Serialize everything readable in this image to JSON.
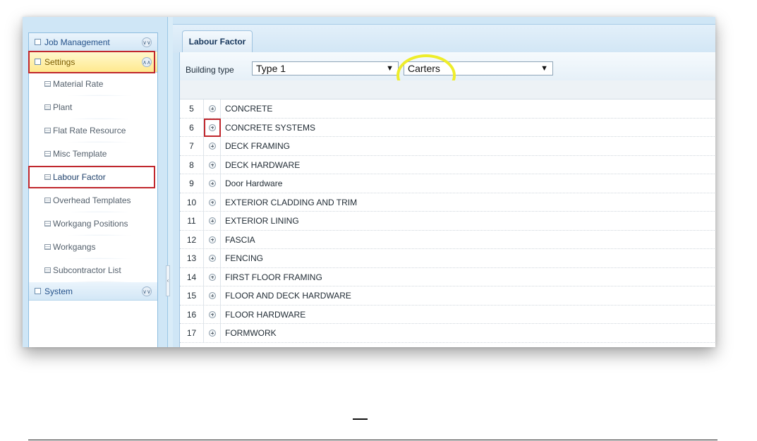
{
  "sidebar": {
    "sections": [
      {
        "label": "Job Management",
        "toggle": "collapsed"
      },
      {
        "label": "Settings",
        "toggle": "expanded"
      },
      {
        "label": "System",
        "toggle": "collapsed"
      }
    ],
    "settings_items": [
      {
        "label": "Material Rate"
      },
      {
        "label": "Plant"
      },
      {
        "label": "Flat Rate Resource"
      },
      {
        "label": "Misc Template"
      },
      {
        "label": "Labour Factor",
        "highlighted": true
      },
      {
        "label": "Overhead Templates"
      },
      {
        "label": "Workgang Positions"
      },
      {
        "label": "Workgangs"
      },
      {
        "label": "Subcontractor List"
      }
    ]
  },
  "tabs": [
    {
      "label": "Labour Factor",
      "active": true
    }
  ],
  "toolbar": {
    "building_type_label": "Building type",
    "building_type_value": "Type 1",
    "company_value": "Carters",
    "dropdown_arrow": "▼"
  },
  "rows": [
    {
      "num": "5",
      "name": "CONCRETE"
    },
    {
      "num": "6",
      "name": "CONCRETE SYSTEMS",
      "expand_highlighted": true
    },
    {
      "num": "7",
      "name": "DECK FRAMING"
    },
    {
      "num": "8",
      "name": "DECK HARDWARE"
    },
    {
      "num": "9",
      "name": "Door Hardware"
    },
    {
      "num": "10",
      "name": "EXTERIOR CLADDING AND TRIM"
    },
    {
      "num": "11",
      "name": "EXTERIOR LINING"
    },
    {
      "num": "12",
      "name": "FASCIA"
    },
    {
      "num": "13",
      "name": "FENCING"
    },
    {
      "num": "14",
      "name": "FIRST FLOOR FRAMING"
    },
    {
      "num": "15",
      "name": "FLOOR AND DECK HARDWARE"
    },
    {
      "num": "16",
      "name": "FLOOR HARDWARE"
    },
    {
      "num": "17",
      "name": "FORMWORK"
    }
  ],
  "colors": {
    "highlight_box": "#c0272d",
    "highlight_circle": "#eeed2b",
    "settings_header": "#ffe98e"
  },
  "icons": {
    "section_toggle_collapsed": "double-chevron-down-icon",
    "section_toggle_expanded": "double-chevron-up-icon",
    "row_expand": "plus-circle-icon"
  }
}
